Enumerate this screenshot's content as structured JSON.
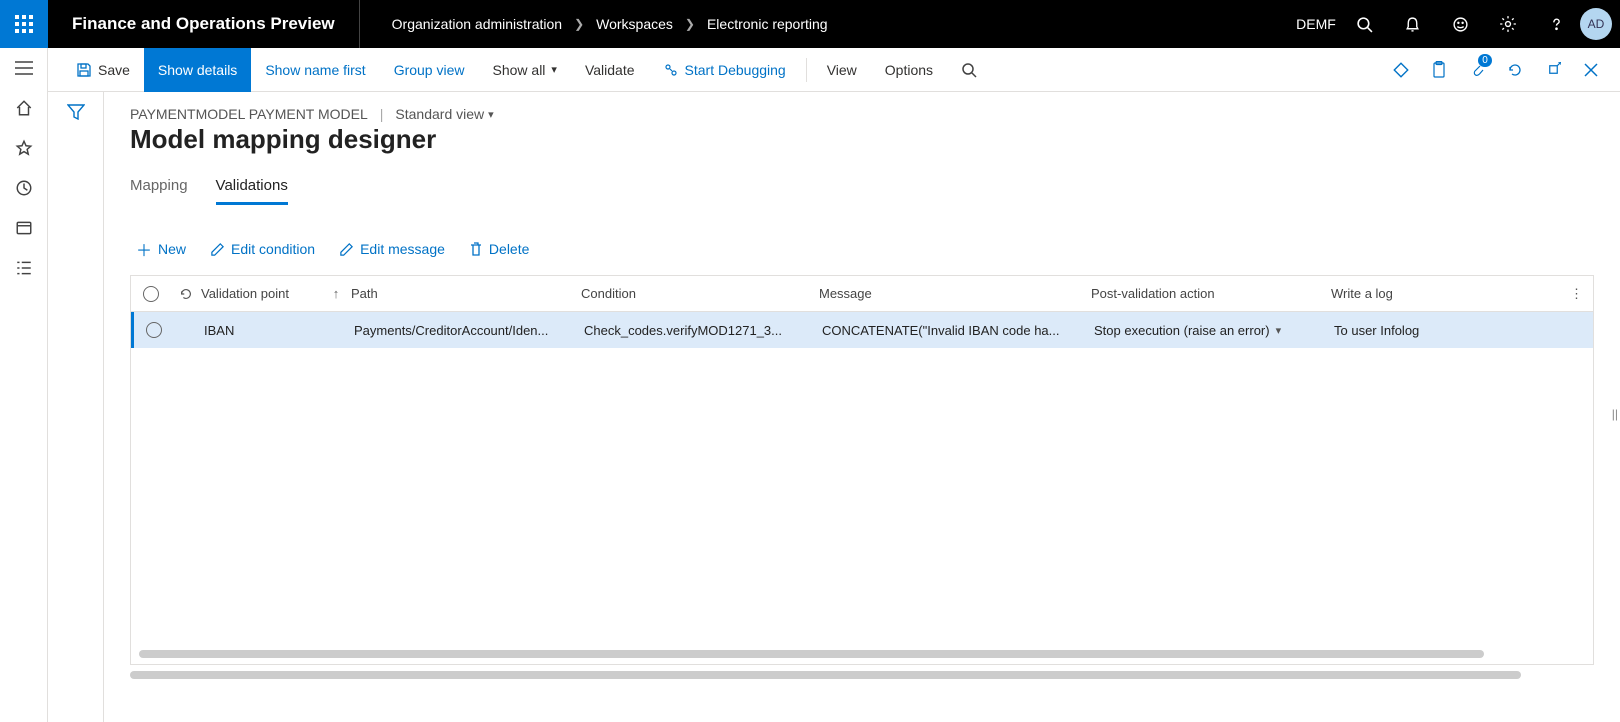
{
  "topbar": {
    "app_title": "Finance and Operations Preview",
    "breadcrumbs": [
      "Organization administration",
      "Workspaces",
      "Electronic reporting"
    ],
    "company": "DEMF",
    "avatar_initials": "AD"
  },
  "actionbar": {
    "save": "Save",
    "show_details": "Show details",
    "show_name_first": "Show name first",
    "group_view": "Group view",
    "show_all": "Show all",
    "validate": "Validate",
    "start_debugging": "Start Debugging",
    "view": "View",
    "options": "Options",
    "attachment_count": "0"
  },
  "page": {
    "model_name_caps": "PAYMENTMODEL PAYMENT MODEL",
    "view_name": "Standard view",
    "title": "Model mapping designer",
    "tabs": {
      "mapping": "Mapping",
      "validations": "Validations"
    }
  },
  "toolbar": {
    "new": "New",
    "edit_condition": "Edit condition",
    "edit_message": "Edit message",
    "delete": "Delete"
  },
  "grid": {
    "headers": {
      "validation_point": "Validation point",
      "path": "Path",
      "condition": "Condition",
      "message": "Message",
      "post_validation_action": "Post-validation action",
      "write_a_log": "Write a log"
    },
    "rows": [
      {
        "validation_point": "IBAN",
        "path": "Payments/CreditorAccount/Iden...",
        "condition": "Check_codes.verifyMOD1271_3...",
        "message": "CONCATENATE(\"Invalid IBAN code ha...",
        "post_validation_action": "Stop execution (raise an error)",
        "write_a_log": "To user Infolog"
      }
    ]
  }
}
